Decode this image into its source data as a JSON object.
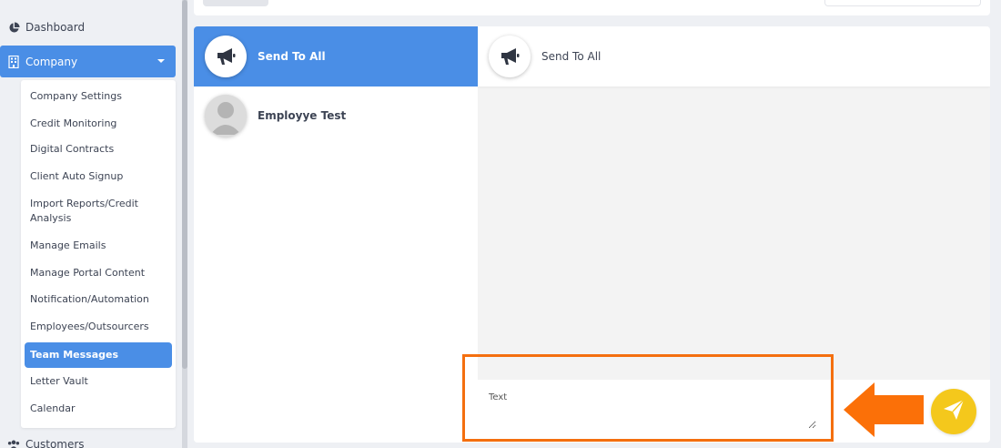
{
  "sidebar": {
    "dashboard_label": "Dashboard",
    "company_label": "Company",
    "customers_label": "Customers",
    "submenu": [
      "Company Settings",
      "Credit Monitoring",
      "Digital Contracts",
      "Client Auto Signup",
      "Import Reports/Credit Analysis",
      "Manage Emails",
      "Manage Portal Content",
      "Notification/Automation",
      "Employees/Outsourcers",
      "Team Messages",
      "Letter Vault",
      "Calendar"
    ],
    "active_submenu_index": 9
  },
  "chat": {
    "contacts": [
      {
        "name": "Send To All",
        "icon": "megaphone-icon",
        "active": true
      },
      {
        "name": "Employye Test",
        "icon": "person-avatar",
        "active": false
      }
    ],
    "header_title": "Send To All",
    "composer_placeholder": "Text",
    "send_icon": "paper-plane-icon"
  },
  "colors": {
    "accent": "#4a8ee6",
    "send_button": "#f4c81c",
    "annotation": "#f46f0f"
  }
}
